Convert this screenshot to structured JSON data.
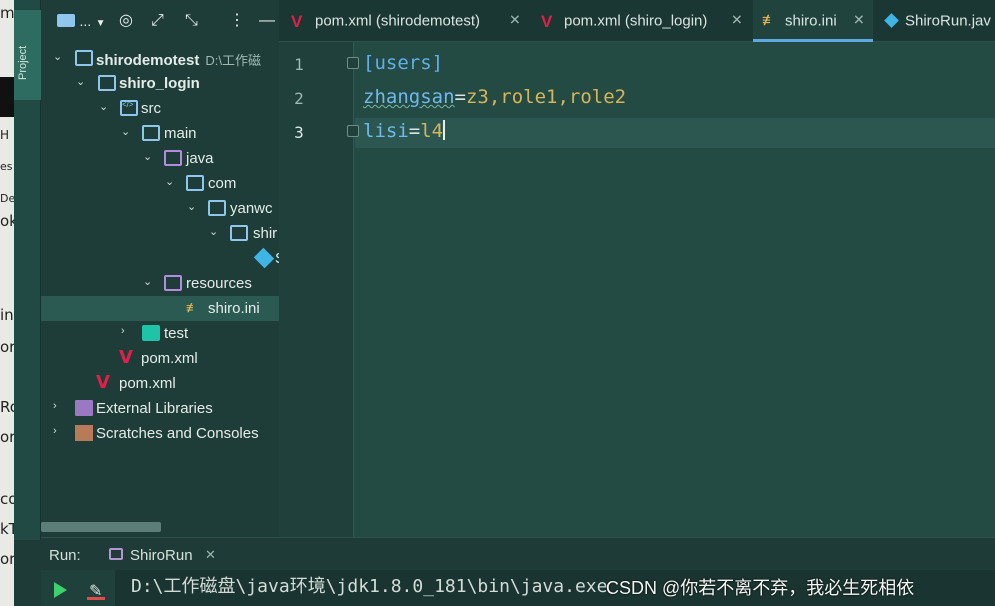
{
  "sliver": {
    "letters": [
      "m",
      "H",
      "es",
      "De",
      "ok",
      "in",
      "or",
      "Ro",
      "or",
      "co",
      "kT",
      "or"
    ]
  },
  "toolwindow": {
    "project_tab": "Project"
  },
  "project_toolbar": {
    "dropdown_label": "...",
    "icons": [
      "folder-icon",
      "target-icon",
      "expand-icon",
      "collapse-icon",
      "more-icon",
      "minimize-icon"
    ]
  },
  "tree": [
    {
      "label": "shirodemotest",
      "path": "D:\\工作磁",
      "level": 0,
      "expanded": true,
      "icon": "folder-icon",
      "bold": true
    },
    {
      "label": "shiro_login",
      "level": 1,
      "expanded": true,
      "icon": "folder-icon",
      "bold": true
    },
    {
      "label": "src",
      "level": 2,
      "expanded": true,
      "icon": "source-folder-icon"
    },
    {
      "label": "main",
      "level": 3,
      "expanded": true,
      "icon": "folder-icon"
    },
    {
      "label": "java",
      "level": 4,
      "expanded": true,
      "icon": "java-folder-icon"
    },
    {
      "label": "com",
      "level": 5,
      "expanded": true,
      "icon": "folder-icon"
    },
    {
      "label": "yanwc",
      "level": 6,
      "expanded": true,
      "icon": "folder-icon"
    },
    {
      "label": "shir",
      "level": 7,
      "expanded": true,
      "icon": "folder-icon"
    },
    {
      "label": "S",
      "level": 8,
      "icon": "class-icon"
    },
    {
      "label": "resources",
      "level": 4,
      "expanded": true,
      "icon": "resources-folder-icon"
    },
    {
      "label": "shiro.ini",
      "level": 5,
      "icon": "ini-file-icon",
      "selected": true
    },
    {
      "label": "test",
      "level": 3,
      "expanded": false,
      "icon": "test-folder-icon"
    },
    {
      "label": "pom.xml",
      "level": 2,
      "icon": "maven-icon"
    },
    {
      "label": "pom.xml",
      "level": 1,
      "icon": "maven-icon"
    },
    {
      "label": "External Libraries",
      "level": 0,
      "expanded": false,
      "icon": "library-icon"
    },
    {
      "label": "Scratches and Consoles",
      "level": 0,
      "expanded": false,
      "icon": "scratches-icon"
    }
  ],
  "tabs": [
    {
      "label": "pom.xml (shirodemotest)",
      "icon": "maven-icon",
      "active": false
    },
    {
      "label": "pom.xml (shiro_login)",
      "icon": "maven-icon",
      "active": false
    },
    {
      "label": "shiro.ini",
      "icon": "ini-file-icon",
      "active": true
    },
    {
      "label": "ShiroRun.jav",
      "icon": "class-icon",
      "active": false
    }
  ],
  "editor": {
    "line_numbers": [
      "1",
      "2",
      "3"
    ],
    "lines": [
      {
        "section": "[users]"
      },
      {
        "key": "zhangsan",
        "eq": "=",
        "value": "z3,role1,role2"
      },
      {
        "key": "lisi",
        "eq": "=",
        "value": "l4"
      }
    ],
    "current_line": 3
  },
  "run": {
    "label": "Run:",
    "config": "ShiroRun",
    "console_line": "D:\\工作磁盘\\java环境\\jdk1.8.0_181\\bin\\java.exe"
  },
  "watermark": "CSDN @你若不离不弃，我必生死相依",
  "colors": {
    "accent": "#5fa8e0",
    "section": "#5fb0e8",
    "value": "#d6b45a",
    "run_green": "#3bd16b",
    "maven_red": "#e0204a"
  }
}
